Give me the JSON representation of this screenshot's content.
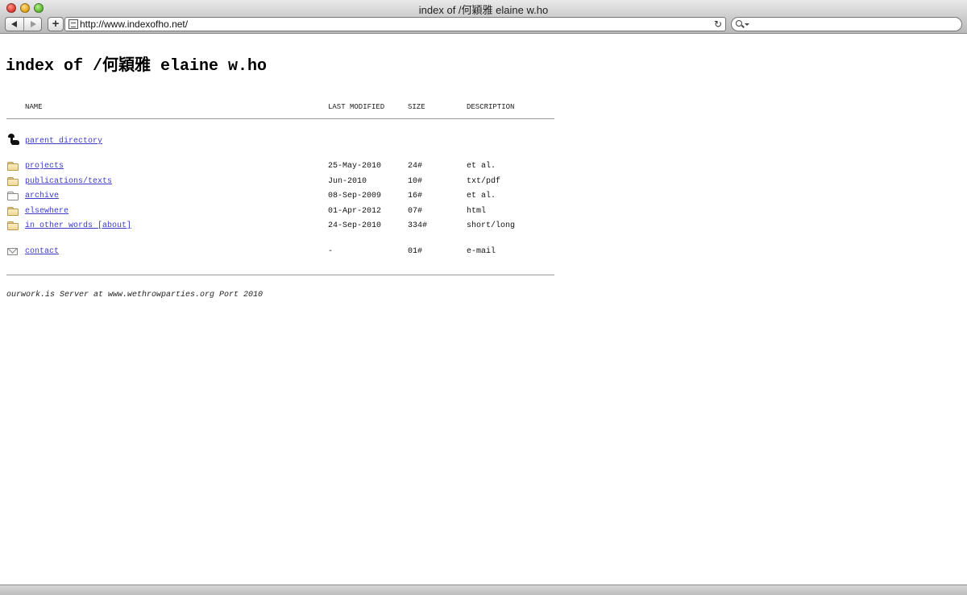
{
  "window": {
    "title": "index of /何穎雅 elaine w.ho"
  },
  "toolbar": {
    "url": "http://www.indexofho.net/",
    "add_label": "+",
    "reload_glyph": "↻"
  },
  "page": {
    "title": "index of /何穎雅 elaine w.ho",
    "columns": {
      "name": "NAME",
      "last_modified": "LAST MODIFIED",
      "size": "SIZE",
      "description": "DESCRIPTION"
    },
    "parent": {
      "label": "parent directory"
    },
    "entries": [
      {
        "name": "projects",
        "modified": "25-May-2010",
        "size": "24#",
        "description": "et al.",
        "icon": "folder-icon"
      },
      {
        "name": "publications/texts",
        "modified": "Jun-2010",
        "size": "10#",
        "description": "txt/pdf",
        "icon": "folder-icon"
      },
      {
        "name": "archive",
        "modified": "08-Sep-2009",
        "size": "16#",
        "description": "et al.",
        "icon": "open-folder-icon"
      },
      {
        "name": "elsewhere",
        "modified": "01-Apr-2012",
        "size": "07#",
        "description": "html",
        "icon": "folder-icon"
      },
      {
        "name": "in other words [about]",
        "modified": "24-Sep-2010",
        "size": "334#",
        "description": "short/long",
        "icon": "folder-icon"
      }
    ],
    "contact": {
      "name": "contact",
      "modified": "-",
      "size": "01#",
      "description": "e-mail",
      "icon": "mail-icon"
    },
    "footer": "ourwork.is Server at www.wethrowparties.org Port 2010"
  },
  "colors": {
    "link": "#3b3bc8",
    "rule": "#999999"
  }
}
